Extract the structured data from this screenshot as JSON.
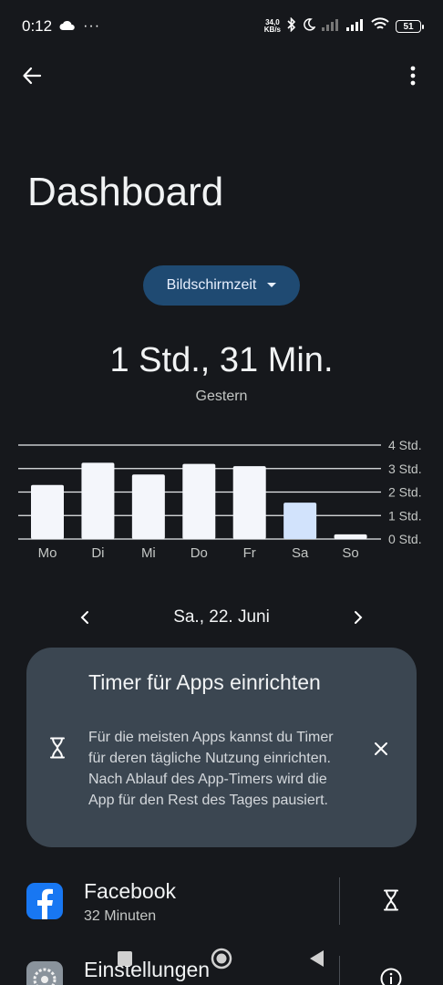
{
  "status": {
    "time": "0:12",
    "more_notifications": "···",
    "net_speed_value": "34,0",
    "net_speed_unit": "KB/s",
    "battery": "51"
  },
  "header": {
    "title": "Dashboard"
  },
  "selector": {
    "label": "Bildschirmzeit"
  },
  "summary": {
    "total": "1 Std., 31 Min.",
    "period": "Gestern"
  },
  "chart_data": {
    "type": "bar",
    "categories": [
      "Mo",
      "Di",
      "Mi",
      "Do",
      "Fr",
      "Sa",
      "So"
    ],
    "values": [
      2.3,
      3.25,
      2.75,
      3.2,
      3.1,
      1.55,
      0.2
    ],
    "highlight_index": 5,
    "ylim": [
      0,
      4
    ],
    "y_ticks": [
      "0 Std.",
      "1 Std.",
      "2 Std.",
      "3 Std.",
      "4 Std."
    ],
    "grid": true,
    "bar_color": "#f4f6fb",
    "highlight_color": "#d2e3fc"
  },
  "date_nav": {
    "label": "Sa., 22. Juni"
  },
  "timer_card": {
    "title": "Timer für Apps einrichten",
    "body": "Für die meisten Apps kannst du Timer für deren tägliche Nutzung einrichten. Nach Ablauf des App-Timers wird die App für den Rest des Tages pausiert."
  },
  "apps": [
    {
      "name": "Facebook",
      "time": "32 Minuten",
      "icon": "facebook-icon",
      "action": "hourglass-icon"
    },
    {
      "name": "Einstellungen",
      "time": "",
      "icon": "settings-gear-icon",
      "action": "info-icon"
    }
  ]
}
